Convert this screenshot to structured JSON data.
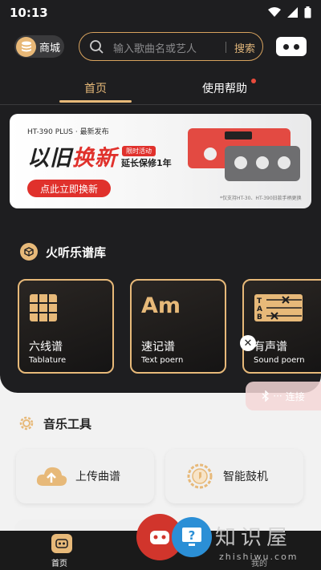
{
  "status_bar": {
    "time": "10:13"
  },
  "header": {
    "shop_label": "商城",
    "search_placeholder": "输入歌曲名或艺人",
    "search_button": "搜索"
  },
  "tabs": [
    {
      "label": "首页",
      "active": true
    },
    {
      "label": "使用帮助",
      "badge": true
    }
  ],
  "banner": {
    "model_line": "HT-390 PLUS · 最新发布",
    "headline_left": "以旧",
    "headline_right": "换新",
    "promo_tag": "限时活动",
    "warranty": "延长保修1年",
    "cta": "点此立即换新",
    "fine_print": "*仅支持HT-30、HT-390旧款手柄更换"
  },
  "library": {
    "title": "火听乐谱库",
    "cards": [
      {
        "name": "六线谱",
        "sub": "Tablature"
      },
      {
        "name": "速记谱",
        "sub": "Text poern",
        "glyph": "Am"
      },
      {
        "name": "有声谱",
        "sub": "Sound poern"
      }
    ]
  },
  "connect": {
    "label": "连接"
  },
  "tools": {
    "title": "音乐工具",
    "items": [
      {
        "label": "上传曲谱",
        "icon": "cloud-upload-icon"
      },
      {
        "label": "智能鼓机",
        "icon": "drum-icon"
      }
    ]
  },
  "nav": {
    "home": "首页",
    "mine": "我的"
  },
  "watermark": {
    "text": "知识屋",
    "url": "zhishiwu.com"
  },
  "colors": {
    "accent": "#e7b979",
    "dark_bg": "#1e1e20",
    "red": "#e0312c"
  }
}
